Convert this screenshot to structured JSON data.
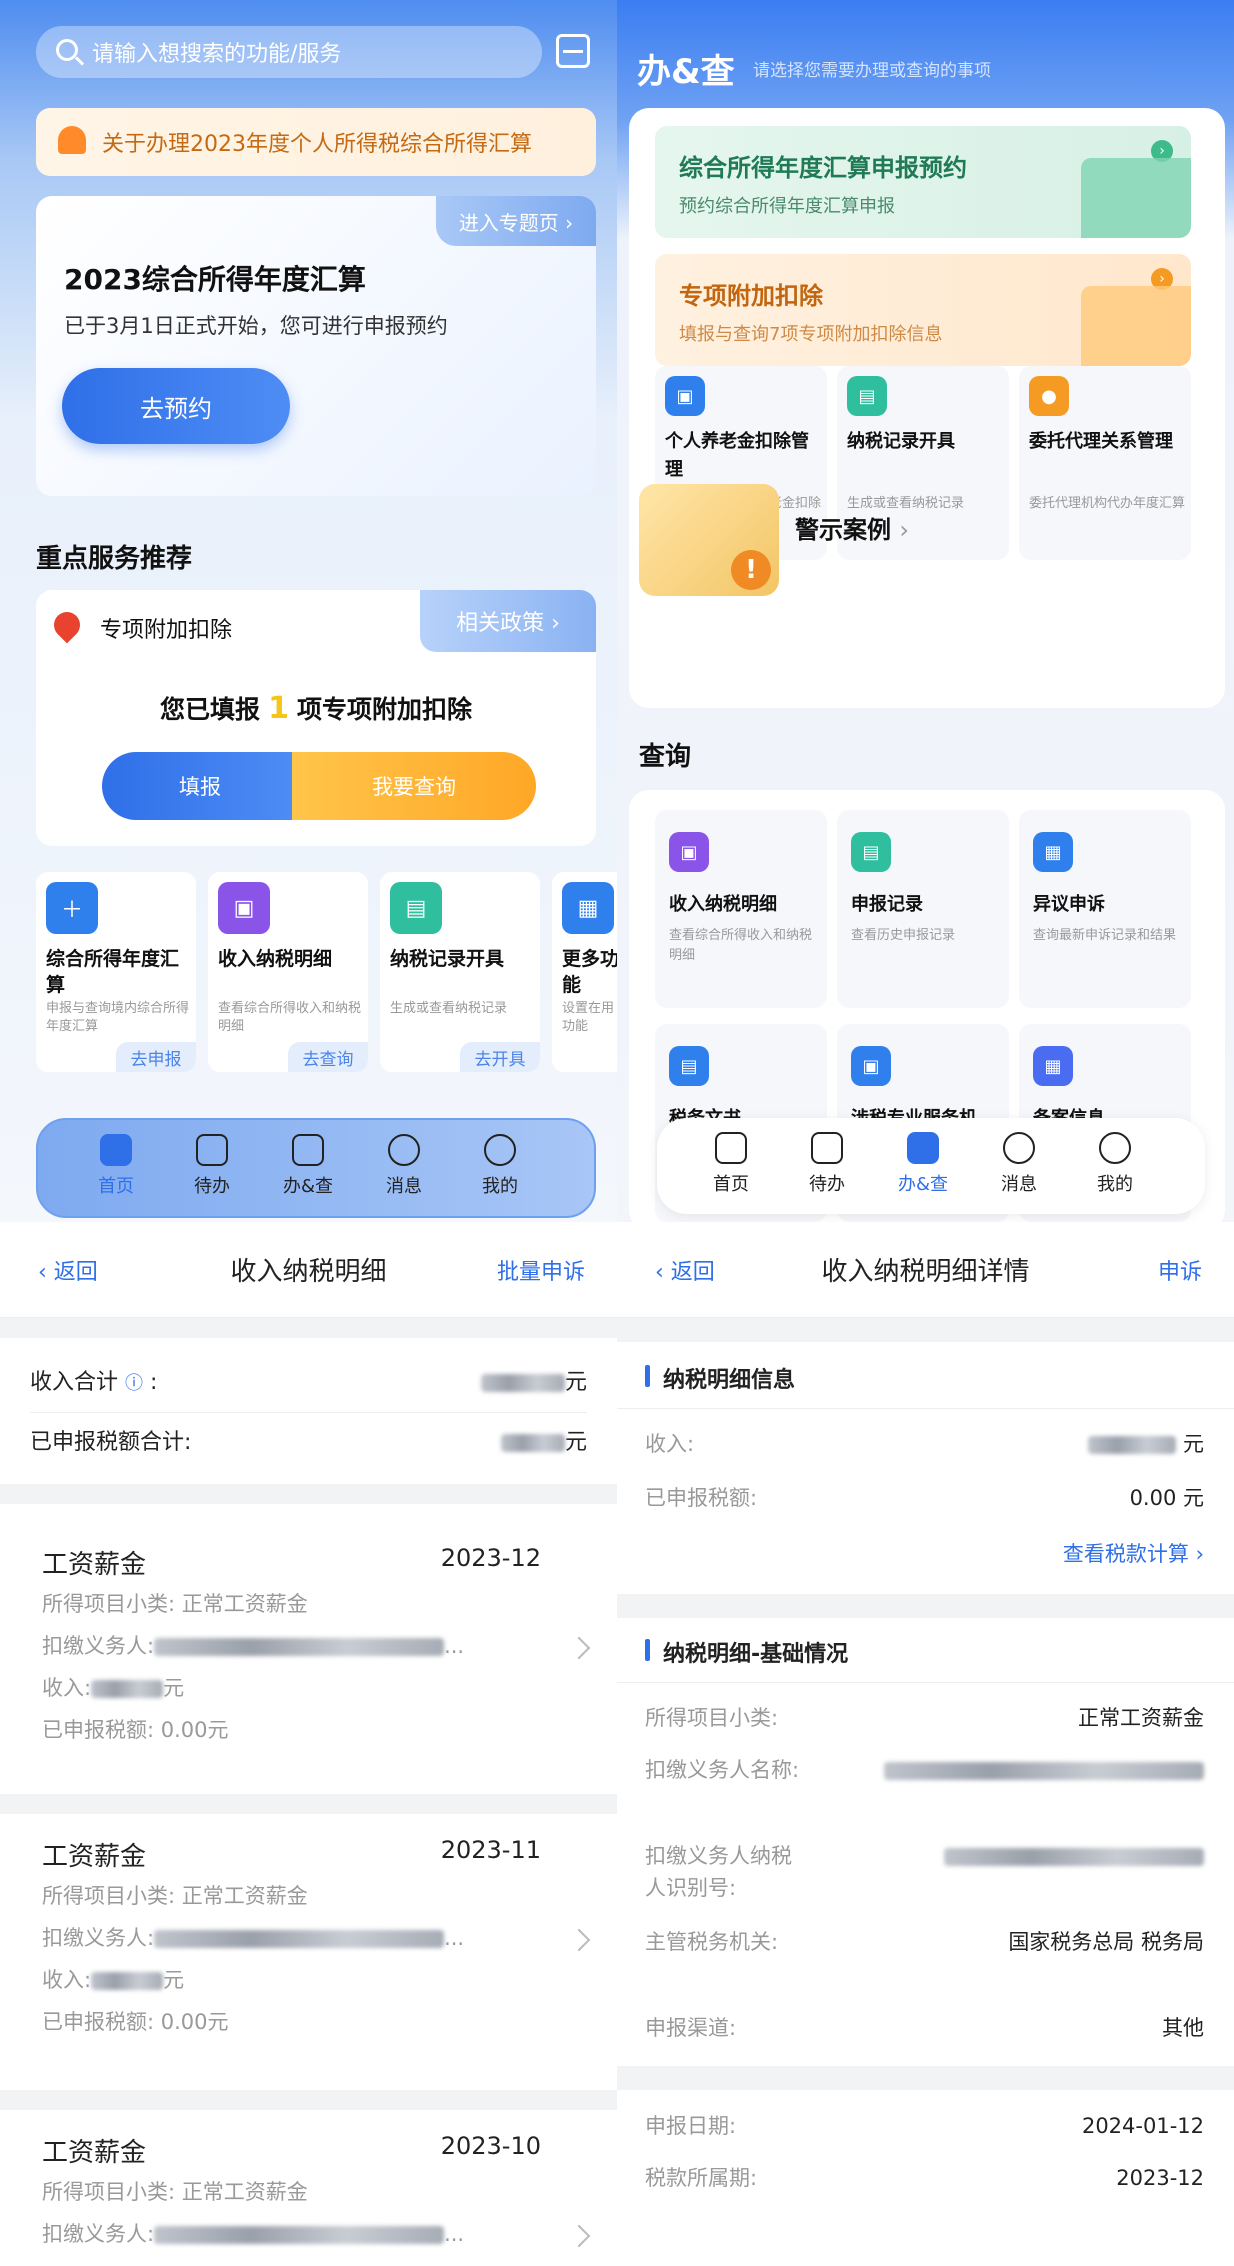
{
  "home": {
    "search_placeholder": "请输入想搜索的功能/服务",
    "notice": "关于办理2023年度个人所得税综合所得汇算",
    "hero": {
      "tag": "进入专题页 ›",
      "title": "2023综合所得年度汇算",
      "desc": "已于3月1日正式开始，您可进行申报预约",
      "button": "去预约"
    },
    "section_title": "重点服务推荐",
    "recommend": {
      "label": "专项附加扣除",
      "policy": "相关政策 ›",
      "stat_prefix": "您已填报",
      "stat_count": "1",
      "stat_suffix": "项专项附加扣除",
      "fill": "填报",
      "query": "我要查询"
    },
    "cards": [
      {
        "title": "综合所得年度汇算",
        "desc": "申报与查询境内综合所得年度汇算",
        "action": "去申报",
        "color": "#2f80ed"
      },
      {
        "title": "收入纳税明细",
        "desc": "查看综合所得收入和纳税明细",
        "action": "去查询",
        "color": "#8a54e8"
      },
      {
        "title": "纳税记录开具",
        "desc": "生成或查看纳税记录",
        "action": "去开具",
        "color": "#2fbf9f"
      },
      {
        "title": "更多功能",
        "desc": "设置在用功能",
        "action": "",
        "color": "#2f80ed"
      }
    ],
    "tabs": [
      "首页",
      "待办",
      "办&查",
      "消息",
      "我的"
    ]
  },
  "ops": {
    "title": "办&查",
    "subtitle": "请选择您需要办理或查询的事项",
    "big1": {
      "title": "综合所得年度汇算申报预约",
      "desc": "预约综合所得年度汇算申报"
    },
    "big2": {
      "title": "专项附加扣除",
      "desc": "填报与查询7项专项附加扣除信息"
    },
    "services": [
      {
        "title": "个人养老金扣除管理",
        "desc": "录入或查看个人养老金扣除信息",
        "color": "#2f80ed"
      },
      {
        "title": "纳税记录开具",
        "desc": "生成或查看纳税记录",
        "color": "#2fbf9f"
      },
      {
        "title": "委托代理关系管理",
        "desc": "委托代理机构代办年度汇算",
        "color": "#f59a23"
      }
    ],
    "warning": "警示案例",
    "query_title": "查询",
    "queries": [
      {
        "title": "收入纳税明细",
        "desc": "查看综合所得收入和纳税明细",
        "color": "#8a54e8"
      },
      {
        "title": "申报记录",
        "desc": "查看历史申报记录",
        "color": "#2fbf9f"
      },
      {
        "title": "异议申诉",
        "desc": "查询最新申诉记录和结果",
        "color": "#2f80ed"
      },
      {
        "title": "税务文书",
        "desc": "",
        "color": "#2f80ed"
      },
      {
        "title": "涉税专业服务机",
        "desc": "",
        "color": "#2f80ed"
      },
      {
        "title": "备案信息",
        "desc": "",
        "color": "#4a6cf0"
      }
    ],
    "tabs": [
      "首页",
      "待办",
      "办&查",
      "消息",
      "我的"
    ]
  },
  "list": {
    "back": "返回",
    "title": "收入纳税明细",
    "action": "批量申诉",
    "income_total_label": "收入合计",
    "income_total_unit": "元",
    "tax_total_label": "已申报税额合计:",
    "tax_total_unit": "元",
    "items": [
      {
        "type": "工资薪金",
        "date": "2023-12",
        "sub_label": "所得项目小类: 正常工资薪金",
        "payer_label": "扣缴义务人:",
        "income_label": "收入:",
        "income_unit": "元",
        "tax": "已申报税额: 0.00元"
      },
      {
        "type": "工资薪金",
        "date": "2023-11",
        "sub_label": "所得项目小类: 正常工资薪金",
        "payer_label": "扣缴义务人:",
        "income_label": "收入:",
        "income_unit": "元",
        "tax": "已申报税额: 0.00元"
      },
      {
        "type": "工资薪金",
        "date": "2023-10",
        "sub_label": "所得项目小类: 正常工资薪金",
        "payer_label": "扣缴义务人:",
        "income_label": "收入:",
        "income_unit": "元",
        "tax": "已申报税额: 0.00元"
      }
    ]
  },
  "detail": {
    "back": "返回",
    "title": "收入纳税明细详情",
    "action": "申诉",
    "sec1": "纳税明细信息",
    "income_label": "收入:",
    "income_unit": "元",
    "tax_label": "已申报税额:",
    "tax_value": "0.00 元",
    "calc_link": "查看税款计算 ›",
    "sec2": "纳税明细-基础情况",
    "rows": [
      {
        "k": "所得项目小类:",
        "v": "正常工资薪金"
      },
      {
        "k": "扣缴义务人名称:",
        "v": ""
      },
      {
        "k": "扣缴义务人纳税人识别号:",
        "v": ""
      },
      {
        "k": "主管税务机关:",
        "v": "国家税务总局 税务局"
      },
      {
        "k": "申报渠道:",
        "v": "其他"
      }
    ],
    "date_label": "申报日期:",
    "date_value": "2024-01-12",
    "period_label": "税款所属期:",
    "period_value": "2023-12"
  }
}
